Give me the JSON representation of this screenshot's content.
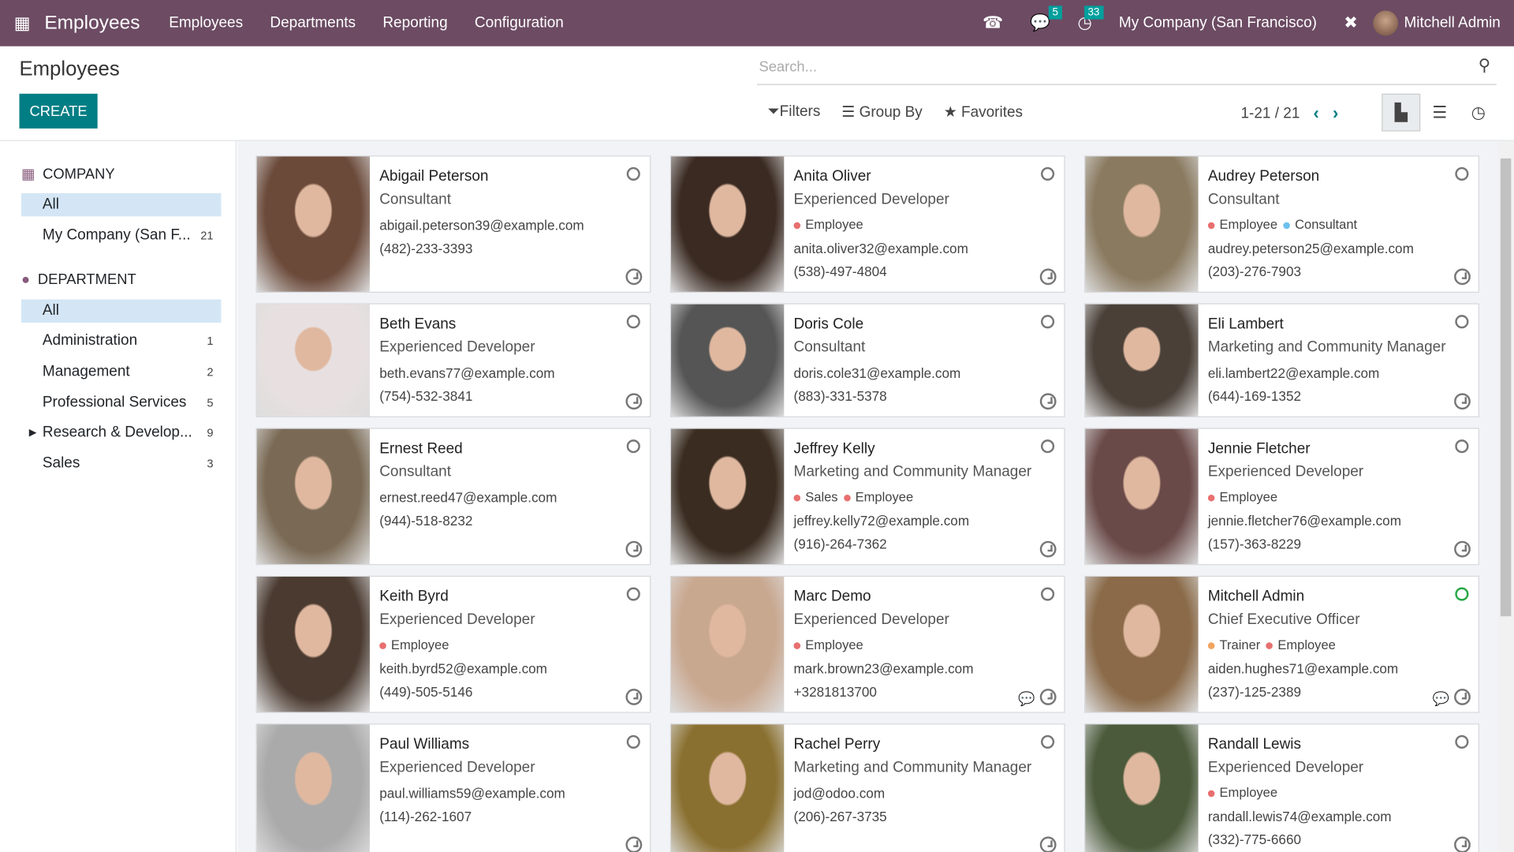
{
  "navbar": {
    "app": "Employees",
    "menus": [
      "Employees",
      "Departments",
      "Reporting",
      "Configuration"
    ],
    "messages_count": "5",
    "activities_count": "33",
    "company": "My Company (San Francisco)",
    "user": "Mitchell Admin"
  },
  "control": {
    "title": "Employees",
    "create": "CREATE",
    "search_placeholder": "Search...",
    "filters": "Filters",
    "group_by": "Group By",
    "favorites": "Favorites",
    "pager": "1-21 / 21"
  },
  "sidebar": {
    "company_header": "COMPANY",
    "company_items": [
      {
        "label": "All",
        "count": ""
      },
      {
        "label": "My Company (San F...",
        "count": "21"
      }
    ],
    "department_header": "DEPARTMENT",
    "department_items": [
      {
        "label": "All",
        "count": ""
      },
      {
        "label": "Administration",
        "count": "1"
      },
      {
        "label": "Management",
        "count": "2"
      },
      {
        "label": "Professional Services",
        "count": "5"
      },
      {
        "label": "Research & Develop...",
        "count": "9"
      },
      {
        "label": "Sales",
        "count": "3"
      }
    ]
  },
  "tag_colors": {
    "Employee": "#e8706f",
    "Consultant": "#6cc1ed",
    "Sales": "#e8706f",
    "Trainer": "#f4a460"
  },
  "employees": [
    {
      "name": "Abigail Peterson",
      "job": "Consultant",
      "tags": [],
      "email": "abigail.peterson39@example.com",
      "phone": "(482)-233-3393",
      "photo": "#6b4a3a"
    },
    {
      "name": "Anita Oliver",
      "job": "Experienced Developer",
      "tags": [
        "Employee"
      ],
      "email": "anita.oliver32@example.com",
      "phone": "(538)-497-4804",
      "photo": "#3a2a22"
    },
    {
      "name": "Audrey Peterson",
      "job": "Consultant",
      "tags": [
        "Employee",
        "Consultant"
      ],
      "email": "audrey.peterson25@example.com",
      "phone": "(203)-276-7903",
      "photo": "#8a7a60"
    },
    {
      "name": "Beth Evans",
      "job": "Experienced Developer",
      "tags": [],
      "email": "beth.evans77@example.com",
      "phone": "(754)-532-3841",
      "photo": "#e8e0e0"
    },
    {
      "name": "Doris Cole",
      "job": "Consultant",
      "tags": [],
      "email": "doris.cole31@example.com",
      "phone": "(883)-331-5378",
      "photo": "#555"
    },
    {
      "name": "Eli Lambert",
      "job": "Marketing and Community Manager",
      "tags": [],
      "email": "eli.lambert22@example.com",
      "phone": "(644)-169-1352",
      "photo": "#4a4038"
    },
    {
      "name": "Ernest Reed",
      "job": "Consultant",
      "tags": [],
      "email": "ernest.reed47@example.com",
      "phone": "(944)-518-8232",
      "photo": "#7a6a55"
    },
    {
      "name": "Jeffrey Kelly",
      "job": "Marketing and Community Manager",
      "tags": [
        "Sales",
        "Employee"
      ],
      "email": "jeffrey.kelly72@example.com",
      "phone": "(916)-264-7362",
      "photo": "#3a2c20"
    },
    {
      "name": "Jennie Fletcher",
      "job": "Experienced Developer",
      "tags": [
        "Employee"
      ],
      "email": "jennie.fletcher76@example.com",
      "phone": "(157)-363-8229",
      "photo": "#6a4a48"
    },
    {
      "name": "Keith Byrd",
      "job": "Experienced Developer",
      "tags": [
        "Employee"
      ],
      "email": "keith.byrd52@example.com",
      "phone": "(449)-505-5146",
      "photo": "#4a3a30"
    },
    {
      "name": "Marc Demo",
      "job": "Experienced Developer",
      "tags": [
        "Employee"
      ],
      "email": "mark.brown23@example.com",
      "phone": "+3281813700",
      "photo": "#c9a890",
      "chat": true
    },
    {
      "name": "Mitchell Admin",
      "job": "Chief Executive Officer",
      "tags": [
        "Trainer",
        "Employee"
      ],
      "email": "aiden.hughes71@example.com",
      "phone": "(237)-125-2389",
      "photo": "#8a6a48",
      "chat": true,
      "online": true
    },
    {
      "name": "Paul Williams",
      "job": "Experienced Developer",
      "tags": [],
      "email": "paul.williams59@example.com",
      "phone": "(114)-262-1607",
      "photo": "#aaa"
    },
    {
      "name": "Rachel Perry",
      "job": "Marketing and Community Manager",
      "tags": [],
      "email": "jod@odoo.com",
      "phone": "(206)-267-3735",
      "photo": "#8a7030"
    },
    {
      "name": "Randall Lewis",
      "job": "Experienced Developer",
      "tags": [
        "Employee"
      ],
      "email": "randall.lewis74@example.com",
      "phone": "(332)-775-6660",
      "photo": "#4a5a3a"
    }
  ]
}
